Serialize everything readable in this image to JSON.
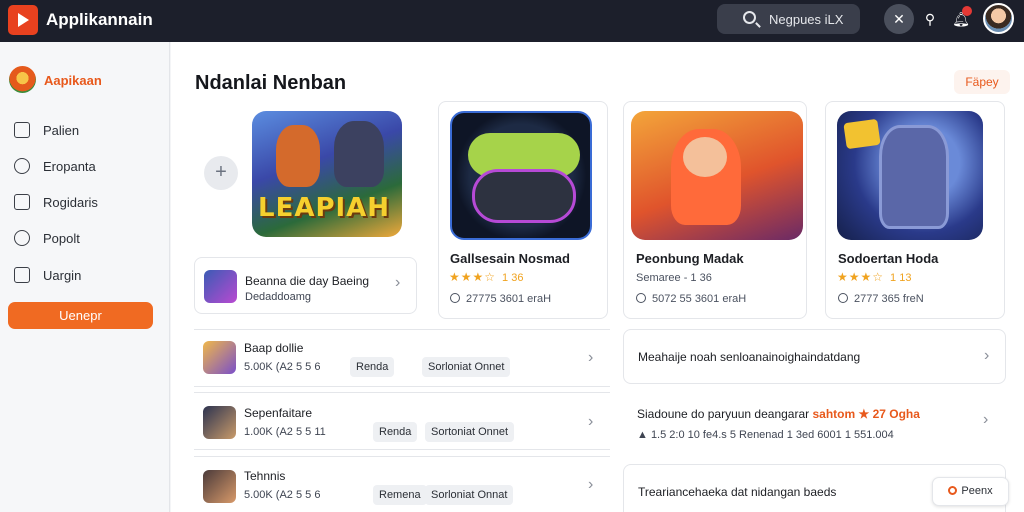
{
  "app": {
    "title": "Applikannain"
  },
  "topbar": {
    "search_text": "Negpues iLX"
  },
  "sidebar": {
    "brand": "Aapikaan",
    "items": [
      {
        "label": "Palien",
        "icon": "square-icon"
      },
      {
        "label": "Eropanta",
        "icon": "users-icon"
      },
      {
        "label": "Rogidaris",
        "icon": "document-icon"
      },
      {
        "label": "Popolt",
        "icon": "bookmark-icon"
      },
      {
        "label": "Uargin",
        "icon": "export-icon"
      }
    ],
    "cta": "Uenepr"
  },
  "main": {
    "title": "Ndanlai Nenban",
    "header_button": "Fäpey",
    "featured_art_text": "LEAPIAH",
    "featured": [
      {
        "title": "Gallsesain Nosmad",
        "stars": "★★★☆",
        "rating": "1 36",
        "meta": "27775 3601 eraH"
      },
      {
        "title": "Peonbung Madak",
        "stars": "",
        "rating": "Semaree - 1 36",
        "meta": "5072 55 3601 eraH"
      },
      {
        "title": "Sodoertan Hoda",
        "stars": "★★★☆",
        "rating": "1 13",
        "meta": "2777 365 freN"
      }
    ],
    "highlight_row": {
      "title": "Beanna die day Baeing",
      "subtitle": "Dedaddoamg"
    },
    "list_rows": [
      {
        "title": "Baap dollie",
        "meta": "5.00K (A2 5 5 6",
        "tags": [
          "Renda",
          "Sorloniat Onnet"
        ]
      },
      {
        "title": "Sepenfaitare",
        "meta": "1.00K (A2 5 5 11",
        "tags": [
          "Renda",
          "Sortoniat Onnet"
        ]
      },
      {
        "title": "Tehnnis",
        "meta": "5.00K (A2 5 5 6",
        "tags": [
          "Remena",
          "Sorloniat Onnat"
        ]
      }
    ],
    "info_cards": [
      {
        "text": "Meahaije noah senloanainoighaindatdang"
      },
      {
        "text": "Siadoune do paryuun deangarar",
        "highlight": "sahtom ★ 27 Ogha",
        "sub": "▲ 1.5 2:0 10 fe4.s 5 Renenad 1 3ed 6001 1 551.004"
      },
      {
        "text": "Treariancehaeka dat nidangan baeds"
      }
    ],
    "small_button": "Peenx"
  }
}
